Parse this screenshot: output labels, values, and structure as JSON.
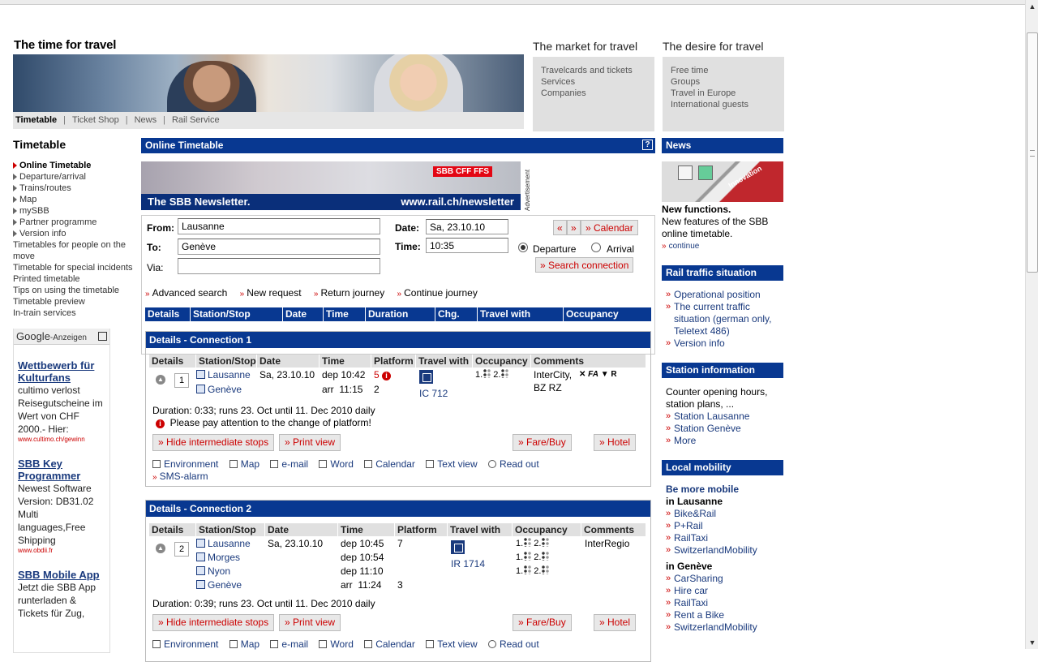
{
  "header": {
    "title": "The time for travel",
    "tabs": [
      "Timetable",
      "Ticket Shop",
      "News",
      "Rail Service"
    ],
    "market": {
      "title": "The market for travel",
      "links": [
        "Travelcards and tickets",
        "Services",
        "Companies"
      ]
    },
    "desire": {
      "title": "The desire for travel",
      "links": [
        "Free time",
        "Groups",
        "Travel in Europe",
        "International guests"
      ]
    }
  },
  "leftnav": {
    "title": "Timetable",
    "items": [
      "Online Timetable",
      "Departure/arrival",
      "Trains/routes",
      "Map",
      "mySBB",
      "Partner programme",
      "Version info"
    ],
    "plain_items": [
      "Timetables for people on the move",
      "Timetable for special incidents",
      "Printed timetable",
      "Tips on using the timetable",
      "Timetable preview",
      "In-train services"
    ]
  },
  "google_ads": {
    "label_brand": "Google",
    "label_suffix": "-Anzeigen",
    "ads": [
      {
        "title": "Wettbewerb für Kulturfans",
        "body": "cultimo verlost Reisegutscheine im Wert von CHF 2000.- Hier:",
        "url": "www.cultimo.ch/gewinn"
      },
      {
        "title": "SBB Key Programmer",
        "body": "Newest Software Version: DB31.02 Multi languages,Free Shipping",
        "url": "www.obdii.fr"
      },
      {
        "title": "SBB Mobile App",
        "body": "Jetzt die SBB App runterladen & Tickets für Zug,",
        "url": ""
      }
    ]
  },
  "main": {
    "title": "Online Timetable",
    "help": "?",
    "newsletter": {
      "logo": "SBB CFF FFS",
      "left": "The SBB Newsletter.",
      "right": "www.rail.ch/newsletter"
    },
    "advertisement_label": "Advertisement",
    "form": {
      "from_label": "From:",
      "from_value": "Lausanne",
      "to_label": "To:",
      "to_value": "Genève",
      "via_label": "Via:",
      "via_value": "",
      "date_label": "Date:",
      "date_value": "Sa, 23.10.10",
      "time_label": "Time:",
      "time_value": "10:35",
      "prev": "«",
      "next": "»",
      "calendar": "» Calendar",
      "departure": "Departure",
      "arrival": "Arrival",
      "search": "» Search connection",
      "links": [
        "Advanced search",
        "New request",
        "Return journey",
        "Continue journey"
      ]
    },
    "result_header": [
      "Details",
      "Station/Stop",
      "Date",
      "Time",
      "Duration",
      "Chg.",
      "Travel with",
      "Occupancy"
    ],
    "connections": [
      {
        "title": "Details - Connection 1",
        "columns": [
          "Details",
          "Station/Stop",
          "Date",
          "Time",
          "Platform",
          "Travel with",
          "Occupancy",
          "Comments"
        ],
        "number": "1",
        "stops": [
          {
            "station": "Lausanne",
            "date": "Sa, 23.10.10",
            "type": "dep",
            "time": "10:42",
            "platform": "5"
          },
          {
            "station": "Genève",
            "date": "",
            "type": "arr",
            "time": "11:15",
            "platform": "2"
          }
        ],
        "train": "IC 712",
        "occupancy": [
          "1.",
          "2."
        ],
        "comments": "InterCity, BZ RZ",
        "comment_symbols": "FA",
        "comment_symbol_r": "R",
        "duration": "Duration: 0:33; runs 23. Oct until 11. Dec 2010 daily",
        "notice": "Please pay attention to the change of platform!",
        "buttons": {
          "hide": "» Hide intermediate stops",
          "print": "» Print view",
          "fare": "» Fare/Buy",
          "hotel": "» Hotel"
        },
        "tools": [
          "Environment",
          "Map",
          "e-mail",
          "Word",
          "Calendar",
          "Text view",
          "Read out"
        ],
        "sms": "SMS-alarm"
      },
      {
        "title": "Details - Connection 2",
        "columns": [
          "Details",
          "Station/Stop",
          "Date",
          "Time",
          "Platform",
          "Travel with",
          "Occupancy",
          "Comments"
        ],
        "number": "2",
        "stops": [
          {
            "station": "Lausanne",
            "date": "Sa, 23.10.10",
            "type": "dep",
            "time": "10:45",
            "platform": "7"
          },
          {
            "station": "Morges",
            "date": "",
            "type": "dep",
            "time": "10:54",
            "platform": ""
          },
          {
            "station": "Nyon",
            "date": "",
            "type": "dep",
            "time": "11:10",
            "platform": ""
          },
          {
            "station": "Genève",
            "date": "",
            "type": "arr",
            "time": "11:24",
            "platform": "3"
          }
        ],
        "train": "IR 1714",
        "occupancy": [
          "1.",
          "2."
        ],
        "comments": "InterRegio",
        "duration": "Duration: 0:39; runs 23. Oct until 11. Dec 2010 daily",
        "buttons": {
          "hide": "» Hide intermediate stops",
          "print": "» Print view",
          "fare": "» Fare/Buy",
          "hotel": "» Hotel"
        },
        "tools": [
          "Environment",
          "Map",
          "e-mail",
          "Word",
          "Calendar",
          "Text view",
          "Read out"
        ]
      }
    ]
  },
  "right": {
    "news": {
      "title": "News",
      "image_text": "Innovation",
      "headline": "New functions.",
      "text": "New features of the SBB online timetable.",
      "more": "continue"
    },
    "traffic": {
      "title": "Rail traffic situation",
      "links": [
        "Operational position",
        "The current traffic situation (german only, Teletext 486)",
        "Version info"
      ]
    },
    "station": {
      "title": "Station information",
      "text": "Counter opening hours, station plans, ...",
      "links": [
        "Station Lausanne",
        "Station Genève",
        "More"
      ]
    },
    "mobility": {
      "title": "Local mobility",
      "subtitle": "Be more mobile",
      "in1": "in Lausanne",
      "links1": [
        "Bike&Rail",
        "P+Rail",
        "RailTaxi",
        "SwitzerlandMobility"
      ],
      "in2": "in Genève",
      "links2": [
        "CarSharing",
        "Hire car",
        "RailTaxi",
        "Rent a Bike",
        "SwitzerlandMobility"
      ]
    }
  }
}
